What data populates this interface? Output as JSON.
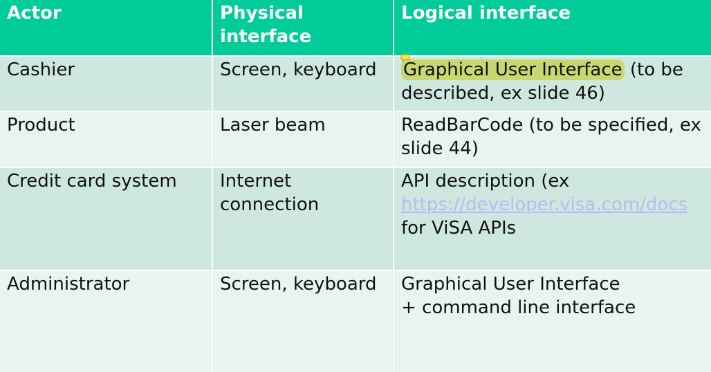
{
  "header": {
    "actor": "Actor",
    "physical": "Physical interface",
    "logical": "Logical interface"
  },
  "rows": [
    {
      "actor": "Cashier",
      "physical": "Screen, keyboard",
      "logical_highlight": "Graphical User Interface",
      "logical_rest": " (to be described, ex slide 46)"
    },
    {
      "actor": "Product",
      "physical": "Laser beam",
      "logical": "ReadBarCode (to be specified, ex slide 44)"
    },
    {
      "actor": "Credit card system",
      "physical": "Internet connection",
      "logical_pre": "API description (ex",
      "logical_link": "https://developer.visa.com/docs",
      "logical_post": "for ViSA APIs"
    },
    {
      "actor": "Administrator",
      "physical": "Screen, keyboard",
      "logical_line1": "Graphical User Interface",
      "logical_line2": "+ command line interface"
    }
  ],
  "colors": {
    "header_bg": "#00cc99",
    "row_dark": "#cfe8df",
    "row_light": "#e8f4ef",
    "highlight": "#c8d870",
    "link": "#b9b9f5"
  },
  "icons": {
    "comment": "comment-icon"
  }
}
